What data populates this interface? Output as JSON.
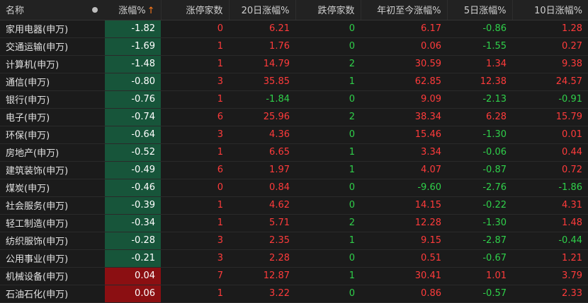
{
  "headers": {
    "name": "名称",
    "change": "涨幅%",
    "limit_up": "涨停家数",
    "day20": "20日涨幅%",
    "limit_down": "跌停家数",
    "ytd": "年初至今涨幅%",
    "day5": "5日涨幅%",
    "day10": "10日涨幅%"
  },
  "icons": {
    "column_dot": "dot-icon",
    "sort": "sort-up-arrow-icon"
  },
  "colors": {
    "up": "#ff3b3b",
    "down": "#2fd04a",
    "sort_arrow": "#ff7a1a",
    "neg_cell_bg": "#17553a",
    "pos_cell_bg": "#8b0f12"
  },
  "rows": [
    {
      "name": "家用电器(申万)",
      "change": "-1.82",
      "limit_up": "0",
      "day20": "6.21",
      "limit_down": "0",
      "ytd": "6.17",
      "day5": "-0.86",
      "day10": "1.28"
    },
    {
      "name": "交通运输(申万)",
      "change": "-1.69",
      "limit_up": "1",
      "day20": "1.76",
      "limit_down": "0",
      "ytd": "0.06",
      "day5": "-1.55",
      "day10": "0.27"
    },
    {
      "name": "计算机(申万)",
      "change": "-1.48",
      "limit_up": "1",
      "day20": "14.79",
      "limit_down": "2",
      "ytd": "30.59",
      "day5": "1.34",
      "day10": "9.38"
    },
    {
      "name": "通信(申万)",
      "change": "-0.80",
      "limit_up": "3",
      "day20": "35.85",
      "limit_down": "1",
      "ytd": "62.85",
      "day5": "12.38",
      "day10": "24.57"
    },
    {
      "name": "银行(申万)",
      "change": "-0.76",
      "limit_up": "1",
      "day20": "-1.84",
      "limit_down": "0",
      "ytd": "9.09",
      "day5": "-2.13",
      "day10": "-0.91"
    },
    {
      "name": "电子(申万)",
      "change": "-0.74",
      "limit_up": "6",
      "day20": "25.96",
      "limit_down": "2",
      "ytd": "38.34",
      "day5": "6.28",
      "day10": "15.79"
    },
    {
      "name": "环保(申万)",
      "change": "-0.64",
      "limit_up": "3",
      "day20": "4.36",
      "limit_down": "0",
      "ytd": "15.46",
      "day5": "-1.30",
      "day10": "0.01"
    },
    {
      "name": "房地产(申万)",
      "change": "-0.52",
      "limit_up": "1",
      "day20": "6.65",
      "limit_down": "1",
      "ytd": "3.34",
      "day5": "-0.06",
      "day10": "0.44"
    },
    {
      "name": "建筑装饰(申万)",
      "change": "-0.49",
      "limit_up": "6",
      "day20": "1.97",
      "limit_down": "1",
      "ytd": "4.07",
      "day5": "-0.87",
      "day10": "0.72"
    },
    {
      "name": "煤炭(申万)",
      "change": "-0.46",
      "limit_up": "0",
      "day20": "0.84",
      "limit_down": "0",
      "ytd": "-9.60",
      "day5": "-2.76",
      "day10": "-1.86"
    },
    {
      "name": "社会服务(申万)",
      "change": "-0.39",
      "limit_up": "1",
      "day20": "4.62",
      "limit_down": "0",
      "ytd": "14.15",
      "day5": "-0.22",
      "day10": "4.31"
    },
    {
      "name": "轻工制造(申万)",
      "change": "-0.34",
      "limit_up": "1",
      "day20": "5.71",
      "limit_down": "2",
      "ytd": "12.28",
      "day5": "-1.30",
      "day10": "1.48"
    },
    {
      "name": "纺织服饰(申万)",
      "change": "-0.28",
      "limit_up": "3",
      "day20": "2.35",
      "limit_down": "1",
      "ytd": "9.15",
      "day5": "-2.87",
      "day10": "-0.44"
    },
    {
      "name": "公用事业(申万)",
      "change": "-0.21",
      "limit_up": "3",
      "day20": "2.28",
      "limit_down": "0",
      "ytd": "0.51",
      "day5": "-0.67",
      "day10": "1.21"
    },
    {
      "name": "机械设备(申万)",
      "change": "0.04",
      "limit_up": "7",
      "day20": "12.87",
      "limit_down": "1",
      "ytd": "30.41",
      "day5": "1.01",
      "day10": "3.79"
    },
    {
      "name": "石油石化(申万)",
      "change": "0.06",
      "limit_up": "1",
      "day20": "3.22",
      "limit_down": "0",
      "ytd": "0.86",
      "day5": "-0.57",
      "day10": "2.33"
    }
  ]
}
